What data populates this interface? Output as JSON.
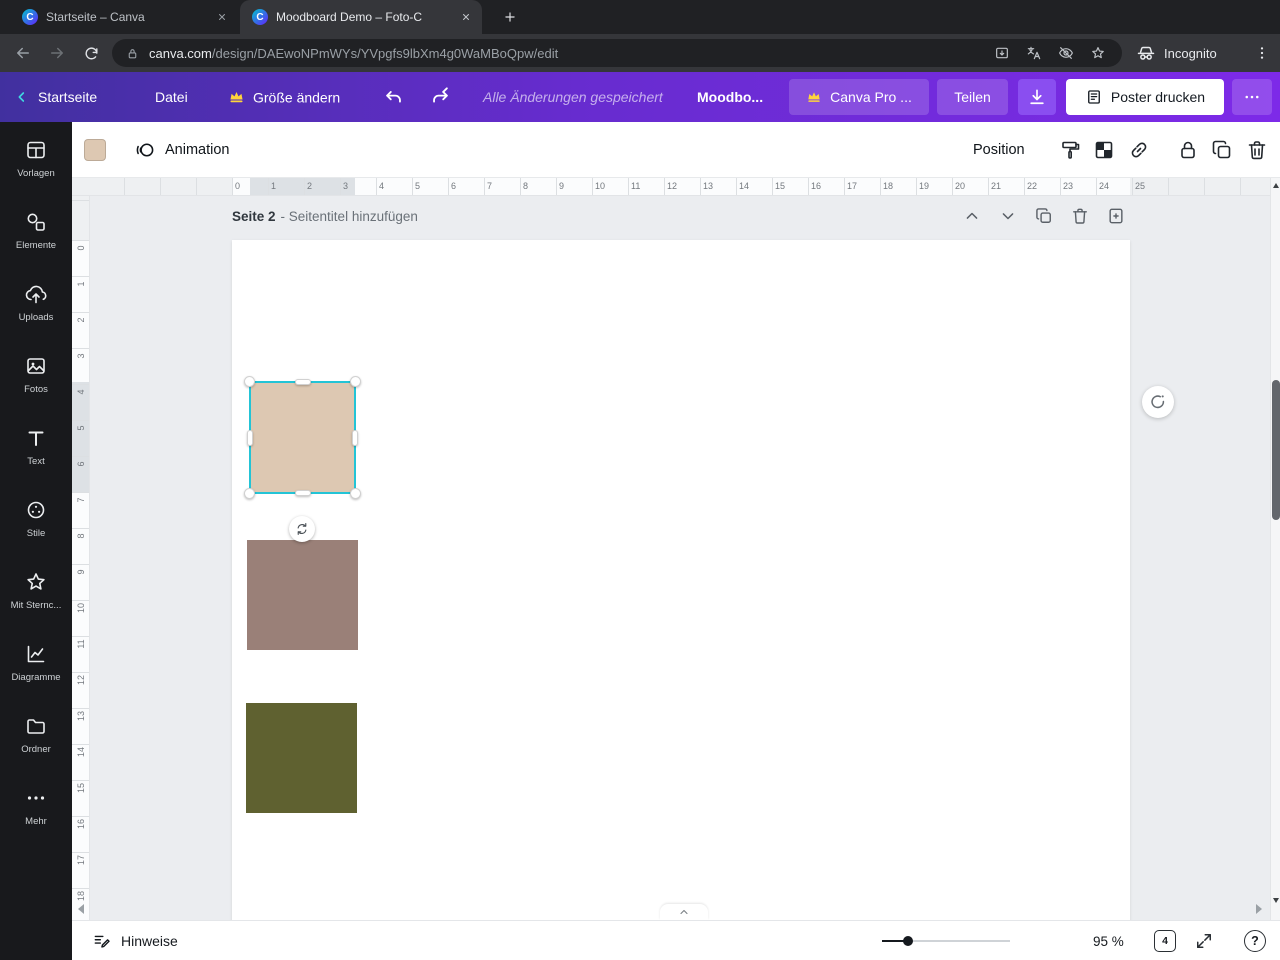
{
  "browser": {
    "tabs": [
      {
        "title": "Startseite – Canva"
      },
      {
        "title": "Moodboard Demo – Foto-C"
      }
    ],
    "favicon_letter": "C",
    "url": {
      "domain": "canva.com",
      "path": "/design/DAEwoNPmWYs/YVpgfs9lbXm4g0WaMBoQpw/edit"
    },
    "incognito_label": "Incognito"
  },
  "header": {
    "back_label": "Startseite",
    "file_menu": "Datei",
    "resize_label": "Größe ändern",
    "saved_status": "Alle Änderungen gespeichert",
    "design_title": "Moodbo...",
    "pro_button": "Canva Pro ...",
    "share_button": "Teilen",
    "print_button": "Poster drucken"
  },
  "sidebar": {
    "items": [
      {
        "label": "Vorlagen"
      },
      {
        "label": "Elemente"
      },
      {
        "label": "Uploads"
      },
      {
        "label": "Fotos"
      },
      {
        "label": "Text"
      },
      {
        "label": "Stile"
      },
      {
        "label": "Mit Sternc..."
      },
      {
        "label": "Diagramme"
      },
      {
        "label": "Ordner"
      },
      {
        "label": "Mehr"
      }
    ]
  },
  "toolbar": {
    "fill_color": "#ddc8b2",
    "animation_label": "Animation",
    "position_label": "Position"
  },
  "page": {
    "title": "Seite 2",
    "subtitle": "- Seitentitel hinzufügen"
  },
  "canvas": {
    "ruler_top": [
      "0",
      "1",
      "2",
      "3",
      "4",
      "5",
      "6",
      "7",
      "8",
      "9",
      "10",
      "11",
      "12",
      "13",
      "14",
      "15",
      "16",
      "17",
      "18",
      "19",
      "20",
      "21",
      "22",
      "23",
      "24",
      "25"
    ],
    "ruler_left": [
      "0",
      "1",
      "2",
      "3",
      "4",
      "5",
      "6",
      "7",
      "8",
      "9",
      "10",
      "11",
      "12",
      "13",
      "14",
      "15",
      "16",
      "17",
      "18"
    ],
    "selection_color": "#23c4d6",
    "shapes": {
      "selected_square_color": "#ddc8b2",
      "mauve_rect_color": "#9a8078",
      "olive_rect_color": "#5f6130"
    }
  },
  "statusbar": {
    "notes_label": "Hinweise",
    "zoom_value": "95 %",
    "page_count": "4",
    "help_glyph": "?"
  }
}
